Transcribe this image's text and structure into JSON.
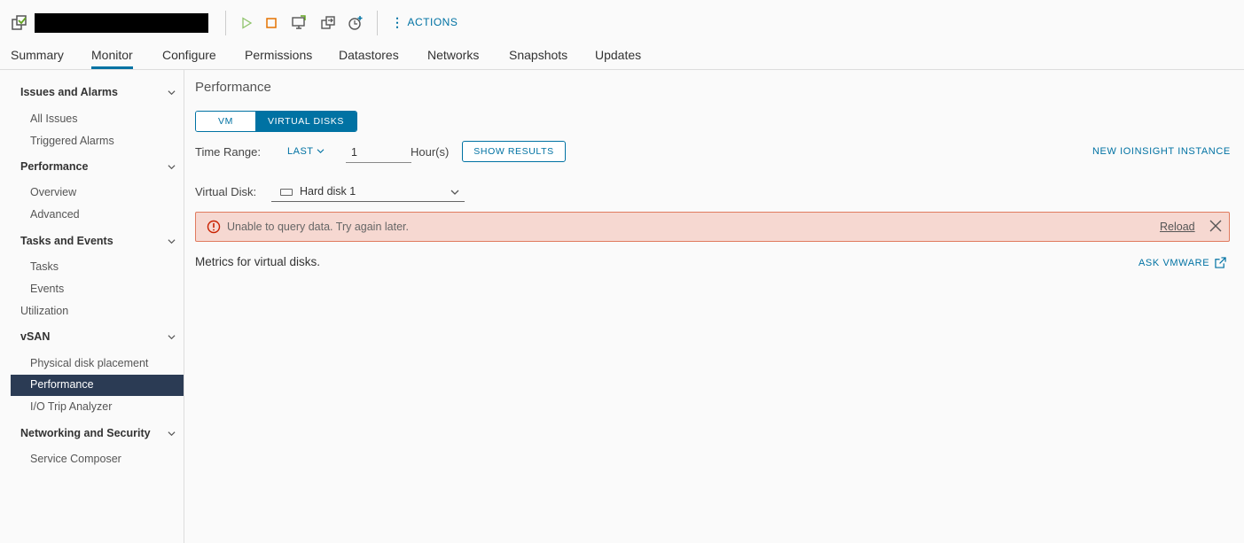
{
  "toolbar": {
    "actions_label": "ACTIONS",
    "icons": [
      "vm-icon",
      "power-on-icon",
      "power-off-icon",
      "launch-console-icon",
      "migrate-icon",
      "snapshot-icon",
      "more-vertical-icon"
    ],
    "colors": {
      "accent": "#0072a3",
      "power_on": "#62a420",
      "power_off": "#e57200"
    }
  },
  "tabs": [
    "Summary",
    "Monitor",
    "Configure",
    "Permissions",
    "Datastores",
    "Networks",
    "Snapshots",
    "Updates"
  ],
  "active_tab": "Monitor",
  "sidebar": {
    "issues_group": "Issues and Alarms",
    "all_issues": "All Issues",
    "triggered_alarms": "Triggered Alarms",
    "performance_group": "Performance",
    "overview": "Overview",
    "advanced": "Advanced",
    "tasks_group": "Tasks and Events",
    "tasks": "Tasks",
    "events": "Events",
    "utilization": "Utilization",
    "vsan_group": "vSAN",
    "physical_disk": "Physical disk placement",
    "vsan_performance": "Performance",
    "io_trip": "I/O Trip Analyzer",
    "networking_group": "Networking and Security",
    "service_composer": "Service Composer",
    "selected_color": "#2b3b54"
  },
  "main": {
    "title": "Performance",
    "seg_vm": "VM",
    "seg_disks": "VIRTUAL DISKS",
    "time_range_label": "Time Range:",
    "last_label": "LAST",
    "hours_value": "1",
    "hours_unit": "Hour(s)",
    "show_results": "SHOW RESULTS",
    "new_ioinsight": "NEW IOINSIGHT INSTANCE",
    "virtual_disk_label": "Virtual Disk:",
    "virtual_disk_value": "Hard disk 1",
    "alert_message": "Unable to query data. Try again later.",
    "alert_reload": "Reload",
    "alert_colors": {
      "bg": "#f6d8d1",
      "border": "#e07b5f",
      "icon": "#c92100"
    },
    "metrics_text": "Metrics for virtual disks.",
    "ask_vmware": "ASK VMWARE"
  }
}
